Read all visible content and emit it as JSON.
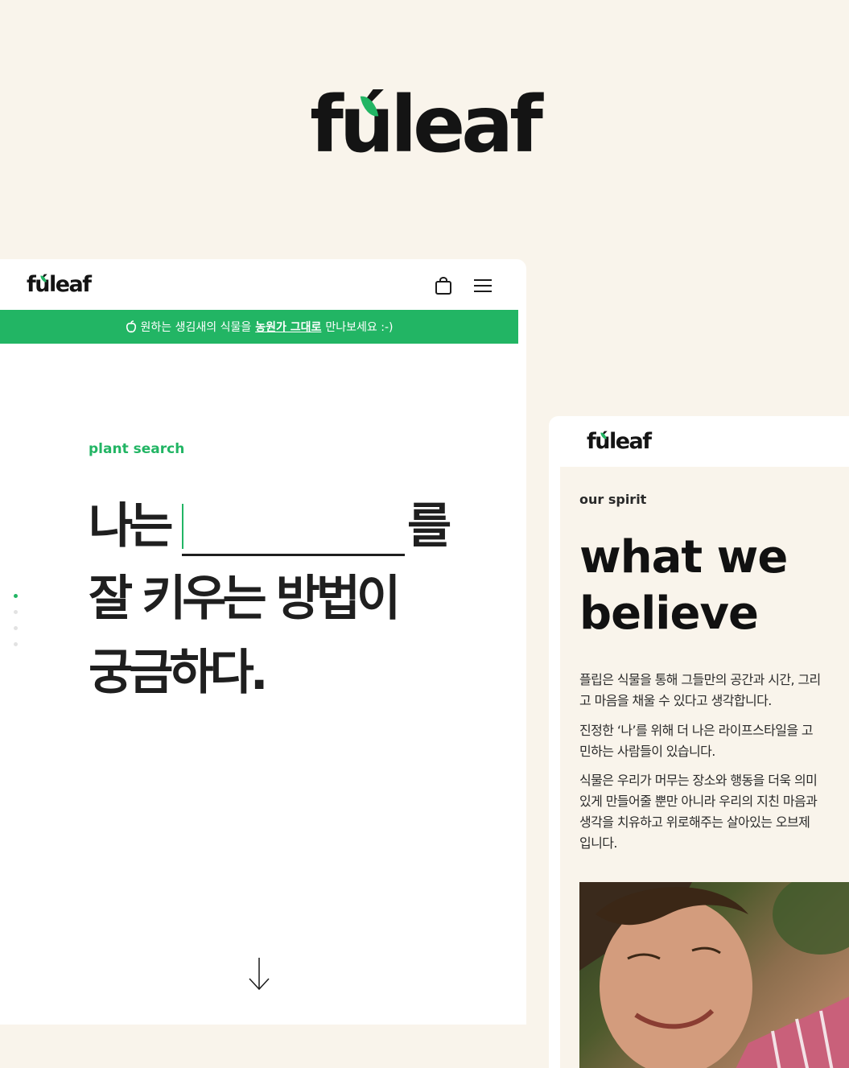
{
  "brand": {
    "logo_text": "fúleaf",
    "accent_color": "#22b564",
    "background": "#f9f4eb"
  },
  "left_mockup": {
    "logo": "fúleaf",
    "icons": {
      "cart": "shopping-bag-icon",
      "menu": "hamburger-menu-icon",
      "scroll": "arrow-down-icon"
    },
    "banner": {
      "icon": "apple-icon",
      "text_before": "원하는 생김새의 식물을",
      "text_highlight": "농원가 그대로",
      "text_after": "만나보세요 :-)"
    },
    "section_label": "plant search",
    "headline": {
      "line1_start": "나는",
      "line1_end": "를",
      "line2": "잘 키우는 방법이",
      "line3": "궁금하다."
    },
    "pagination": {
      "total": 4,
      "active_index": 0
    }
  },
  "right_mockup": {
    "logo": "fúleaf",
    "section_label": "our spirit",
    "title_line1": "what we",
    "title_line2": "believe",
    "paragraph1": "플립은 식물을 통해 그들만의 공간과 시간, 그리고 마음을 채울 수 있다고 생각합니다.",
    "paragraph2": "진정한 ‘나’를 위해 더 나은 라이프스타일을 고민하는 사람들이 있습니다.",
    "paragraph3": "식물은 우리가 머무는 장소와 행동을 더욱 의미 있게 만들어줄 뿐만 아니라 우리의 지친 마음과 생각을 치유하고 위로해주는 살아있는 오브제입니다."
  }
}
